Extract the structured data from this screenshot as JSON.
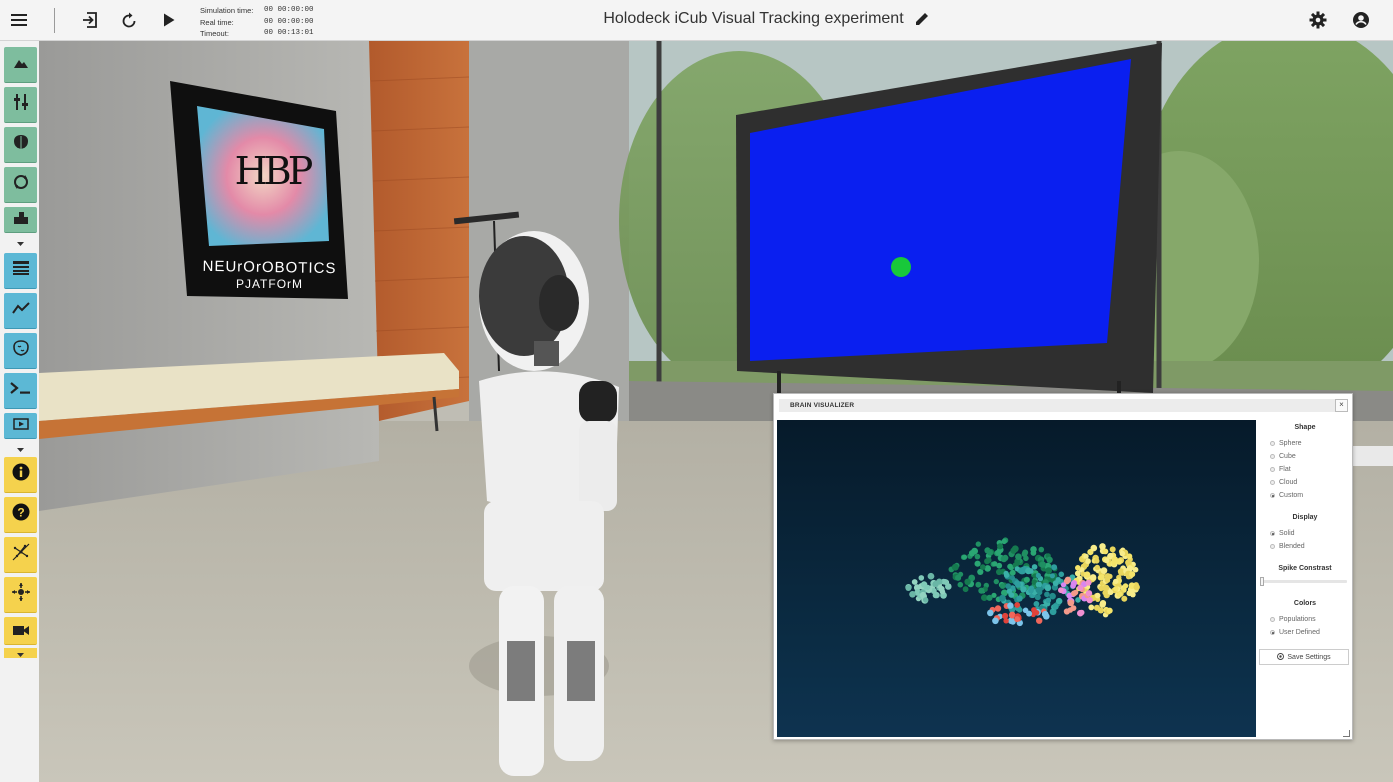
{
  "topbar": {
    "title": "Holodeck iCub Visual Tracking experiment",
    "menu_icon": "hamburger-menu-icon",
    "exit_icon": "exit-icon",
    "reset_icon": "reset-icon",
    "play_icon": "play-icon",
    "edit_icon": "pencil-icon",
    "settings_icon": "gear-icon",
    "account_icon": "account-circle-icon",
    "simulation_time_label": "Simulation time:",
    "simulation_time_value": "00 00:00:00",
    "real_time_label": "Real time:",
    "real_time_value": "00 00:00:00",
    "timeout_label": "Timeout:",
    "timeout_value": "00 00:13:01"
  },
  "sidebar": {
    "colors": {
      "green": "#7ebd9e",
      "teal": "#5cb8d5",
      "yellow": "#f5d24d"
    },
    "buttons": [
      "environment-icon",
      "object-library-icon",
      "brain-editor-icon",
      "transfer-function-icon",
      "robot-designer-icon",
      "log-console-icon",
      "spike-train-icon",
      "brain-visualizer-icon",
      "terminal-icon",
      "video-stream-icon",
      "info-icon",
      "help-icon",
      "joint-plot-icon",
      "robot-inspector-icon",
      "recorder-icon"
    ]
  },
  "scene": {
    "poster_logo": "HBP",
    "poster_text_line1": "NEUrOrOBOTICS",
    "poster_text_line2": "PJATFOrM",
    "screen_color": "#0a1ff0",
    "target_color": "#18c83a"
  },
  "brain_visualizer": {
    "title": "BRAIN VISUALIZER",
    "close_label": "×",
    "shape_heading": "Shape",
    "shape_options": [
      "Sphere",
      "Cube",
      "Flat",
      "Cloud",
      "Custom"
    ],
    "shape_selected": "Custom",
    "display_heading": "Display",
    "display_options": [
      "Solid",
      "Blended"
    ],
    "display_selected": "Solid",
    "spike_contrast_heading": "Spike Constrast",
    "spike_contrast_level": 0.0,
    "colors_heading": "Colors",
    "colors_options": [
      "Populations",
      "User Defined"
    ],
    "colors_selected": "User Defined",
    "save_label": "Save Settings",
    "save_icon": "save-circle-icon"
  }
}
